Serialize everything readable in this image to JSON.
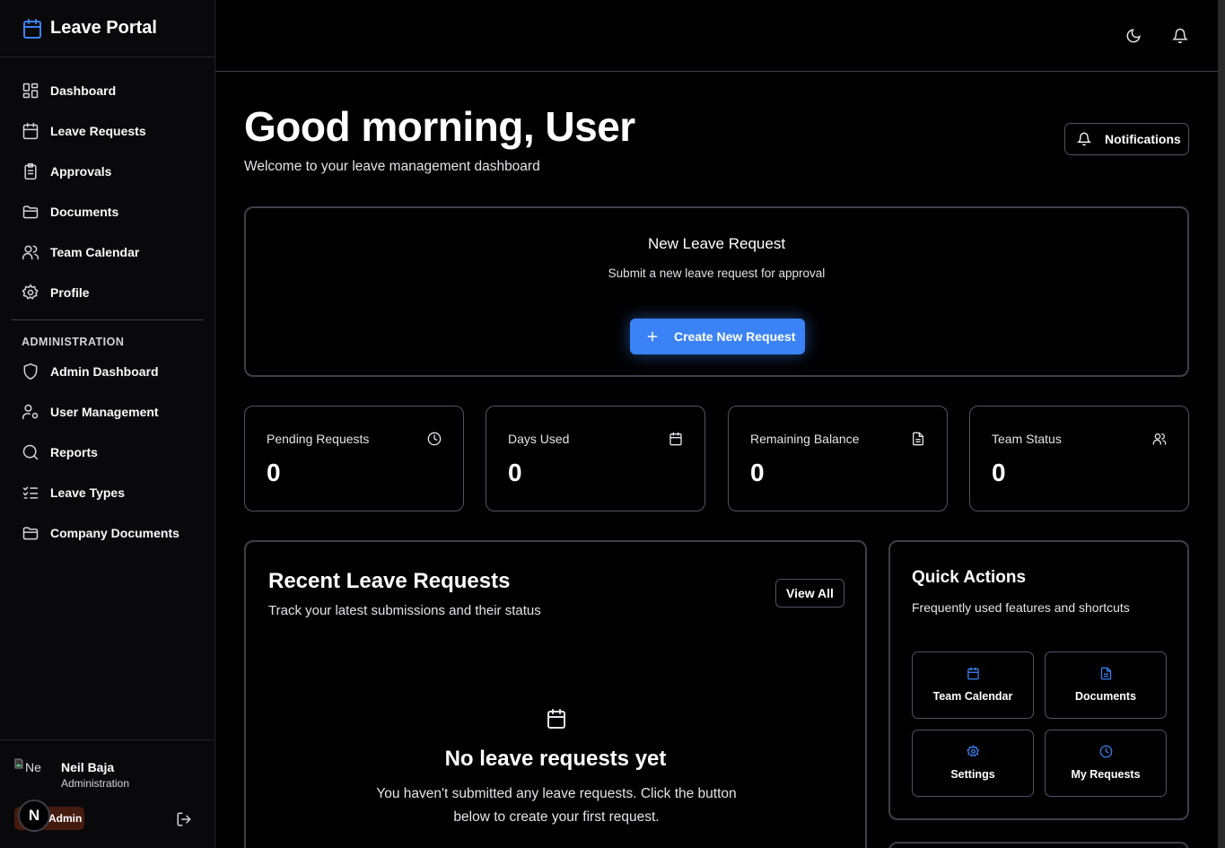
{
  "brand": {
    "title": "Leave Portal",
    "icon": "calendar-icon"
  },
  "nav": {
    "main": [
      {
        "label": "Dashboard",
        "icon": "dashboard-icon"
      },
      {
        "label": "Leave Requests",
        "icon": "calendar-icon"
      },
      {
        "label": "Approvals",
        "icon": "clipboard-icon"
      },
      {
        "label": "Documents",
        "icon": "folder-icon"
      },
      {
        "label": "Team Calendar",
        "icon": "users-icon"
      },
      {
        "label": "Profile",
        "icon": "gear-icon"
      }
    ],
    "section_label": "ADMINISTRATION",
    "admin": [
      {
        "label": "Admin Dashboard",
        "icon": "shield-icon"
      },
      {
        "label": "User Management",
        "icon": "user-cog-icon"
      },
      {
        "label": "Reports",
        "icon": "search-icon"
      },
      {
        "label": "Leave Types",
        "icon": "list-checks-icon"
      },
      {
        "label": "Company Documents",
        "icon": "folder-icon"
      }
    ]
  },
  "user": {
    "avatar_alt": "Ne",
    "name": "Neil Baja",
    "role": "Administration",
    "badge": "Admin",
    "initial": "N"
  },
  "header": {
    "greeting": "Good morning, User",
    "subtitle": "Welcome to your leave management dashboard",
    "notifications_label": "Notifications"
  },
  "new_request": {
    "title": "New Leave Request",
    "subtitle": "Submit a new leave request for approval",
    "button_label": "Create New Request"
  },
  "stats": [
    {
      "label": "Pending Requests",
      "value": "0",
      "icon": "clock-icon"
    },
    {
      "label": "Days Used",
      "value": "0",
      "icon": "calendar-icon"
    },
    {
      "label": "Remaining Balance",
      "value": "0",
      "icon": "file-icon"
    },
    {
      "label": "Team Status",
      "value": "0",
      "icon": "users-icon"
    }
  ],
  "recent": {
    "title": "Recent Leave Requests",
    "subtitle": "Track your latest submissions and their status",
    "view_all": "View All",
    "empty_title": "No leave requests yet",
    "empty_text": "You haven't submitted any leave requests. Click the button below to create your first request."
  },
  "quick_actions": {
    "title": "Quick Actions",
    "subtitle": "Frequently used features and shortcuts",
    "items": [
      {
        "label": "Team Calendar",
        "icon": "calendar-icon"
      },
      {
        "label": "Documents",
        "icon": "file-icon"
      },
      {
        "label": "Settings",
        "icon": "gear-icon"
      },
      {
        "label": "My Requests",
        "icon": "clock-icon"
      }
    ]
  },
  "colors": {
    "accent": "#3b82f6",
    "background": "#000000",
    "sidebar": "#09090b",
    "border": "#3f3f46",
    "badge": "#451a0f"
  }
}
